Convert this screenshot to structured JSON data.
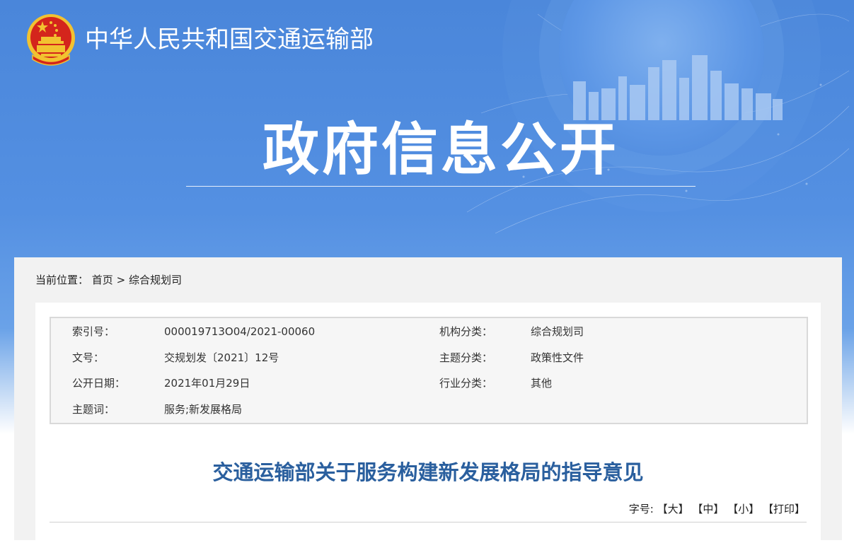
{
  "header": {
    "site_title": "中华人民共和国交通运输部",
    "page_title": "政府信息公开"
  },
  "breadcrumb": {
    "prefix": "当前位置：",
    "items": [
      "首页",
      "综合规划司"
    ],
    "separator": ">"
  },
  "meta": {
    "index_label": "索引号：",
    "index_value": "000019713O04/2021-00060",
    "org_label": "机构分类：",
    "org_value": "综合规划司",
    "docno_label": "文号：",
    "docno_value": "交规划发〔2021〕12号",
    "topic_label": "主题分类：",
    "topic_value": "政策性文件",
    "date_label": "公开日期：",
    "date_value": "2021年01月29日",
    "industry_label": "行业分类：",
    "industry_value": "其他",
    "keywords_label": "主题词：",
    "keywords_value": "服务;新发展格局"
  },
  "document": {
    "title": "交通运输部关于服务构建新发展格局的指导意见"
  },
  "font_controls": {
    "label": "字号:",
    "large": "【大】",
    "medium": "【中】",
    "small": "【小】",
    "print": "【打印】"
  },
  "colors": {
    "hero_blue": "#4a86da",
    "title_blue": "#2a5f9e",
    "emblem_red": "#d4251c",
    "emblem_gold": "#f2c230"
  }
}
